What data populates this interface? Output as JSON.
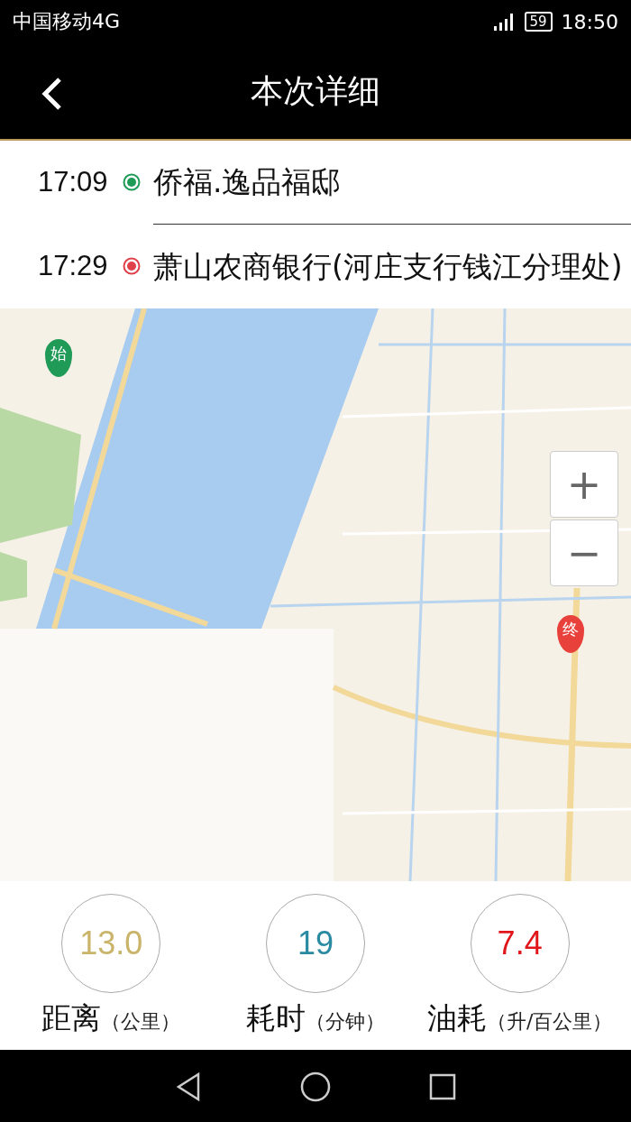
{
  "status_bar": {
    "carrier": "中国移动4G",
    "battery": "59",
    "time": "18:50"
  },
  "header": {
    "title": "本次详细"
  },
  "route": [
    {
      "time": "17:09",
      "kind": "start",
      "place": "侨福.逸品福邸"
    },
    {
      "time": "17:29",
      "kind": "end",
      "place": "萧山农商银行(河庄支行钱江分理处)"
    }
  ],
  "map": {
    "kind": "picture",
    "start_pin": "始",
    "end_pin": "终",
    "zoom_in": "+",
    "zoom_out": "−"
  },
  "stats": [
    {
      "value": "13.0",
      "color": "#c9b46a",
      "label": "距离",
      "unit": "（公里）"
    },
    {
      "value": "19",
      "color": "#2a8aa2",
      "label": "耗时",
      "unit": "（分钟）"
    },
    {
      "value": "7.4",
      "color": "#e0161b",
      "label": "油耗",
      "unit": "（升/百公里）"
    }
  ]
}
